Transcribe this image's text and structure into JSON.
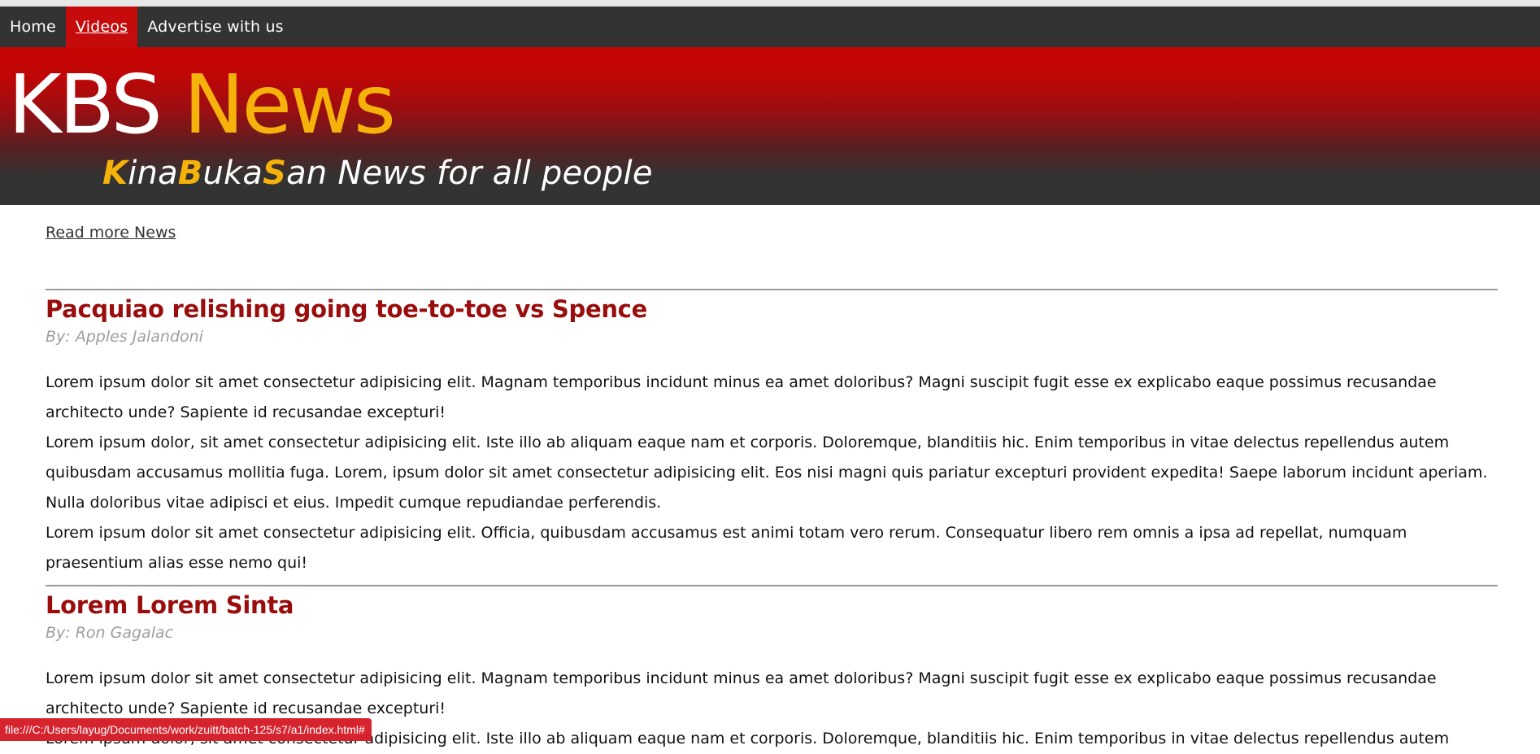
{
  "nav": {
    "items": [
      {
        "label": "Home"
      },
      {
        "label": "Videos",
        "active": true
      },
      {
        "label": "Advertise with us"
      }
    ]
  },
  "header": {
    "brand_part1": "KBS",
    "brand_part2": "News",
    "tagline": {
      "k": "K",
      "ina": "ina",
      "b": "B",
      "uka": "uka",
      "s": "S",
      "rest": "an News for all people"
    }
  },
  "main": {
    "read_more": "Read more News",
    "articles": [
      {
        "title": "Pacquiao relishing going toe-to-toe vs Spence",
        "author": "By: Apples Jalandoni",
        "paragraphs": [
          "Lorem ipsum dolor sit amet consectetur adipisicing elit. Magnam temporibus incidunt minus ea amet doloribus? Magni suscipit fugit esse ex explicabo eaque possimus recusandae architecto unde? Sapiente id recusandae excepturi!",
          "Lorem ipsum dolor, sit amet consectetur adipisicing elit. Iste illo ab aliquam eaque nam et corporis. Doloremque, blanditiis hic. Enim temporibus in vitae delectus repellendus autem quibusdam accusamus mollitia fuga. Lorem, ipsum dolor sit amet consectetur adipisicing elit. Eos nisi magni quis pariatur excepturi provident expedita! Saepe laborum incidunt aperiam. Nulla doloribus vitae adipisci et eius. Impedit cumque repudiandae perferendis.",
          "Lorem ipsum dolor sit amet consectetur adipisicing elit. Officia, quibusdam accusamus est animi totam vero rerum. Consequatur libero rem omnis a ipsa ad repellat, numquam praesentium alias esse nemo qui!"
        ]
      },
      {
        "title": "Lorem Lorem Sinta",
        "author": "By: Ron Gagalac",
        "paragraphs": [
          "Lorem ipsum dolor sit amet consectetur adipisicing elit. Magnam temporibus incidunt minus ea amet doloribus? Magni suscipit fugit esse ex explicabo eaque possimus recusandae architecto unde? Sapiente id recusandae excepturi!",
          "Lorem ipsum dolor, sit amet consectetur adipisicing elit. Iste illo ab aliquam eaque nam et corporis. Doloremque, blanditiis hic. Enim temporibus in vitae delectus repellendus autem"
        ]
      }
    ]
  },
  "status_bar": {
    "url": "file:///C:/Users/layug/Documents/work/zuitt/batch-125/s7/a1/index.html#"
  },
  "colors": {
    "nav_bg": "#333333",
    "nav_active": "#c50b0b",
    "brand_accent": "#f5b20a",
    "title_red": "#9a0d0d",
    "byline_gray": "#9e9e9e"
  }
}
